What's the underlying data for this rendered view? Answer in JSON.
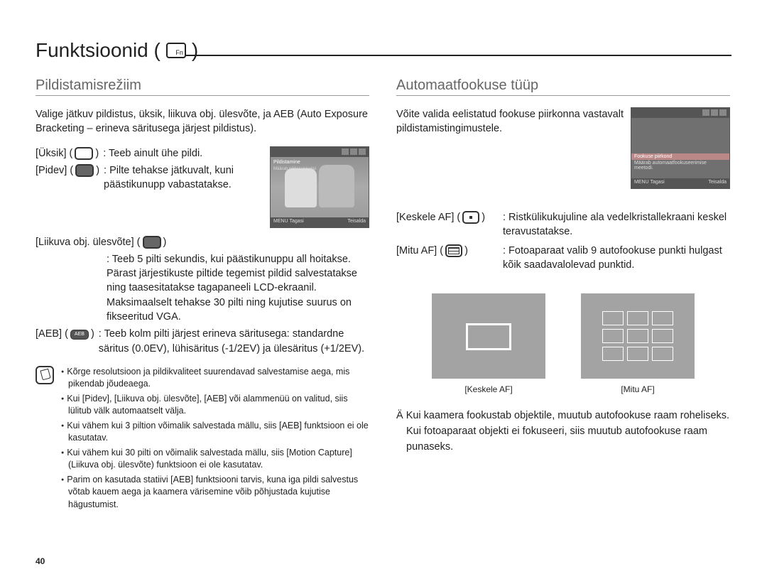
{
  "title": "Funktsioonid (",
  "title_close": ")",
  "left": {
    "heading": "Pildistamisrežiim",
    "intro": "Valige jätkuv pildistus, üksik, liikuva obj. ülesvõte, ja AEB (Auto Exposure Bracketing – erineva säritusega järjest pildistus).",
    "opt_single_label": "[Üksik] (",
    "opt_single_close": ")",
    "opt_single_desc": ": Teeb ainult ühe pildi.",
    "opt_cont_label": "[Pidev] (",
    "opt_cont_close": ")",
    "opt_cont_desc": ": Pilte tehakse jätkuvalt, kuni päästikunupp vabastatakse.",
    "opt_motion_label": "[Liikuva obj. ülesvõte] (",
    "opt_motion_close": ")",
    "opt_motion_desc": ": Teeb 5 pilti sekundis, kui päästikunuppu all hoitakse. Pärast järjestikuste piltide tegemist pildid salvestatakse ning taasesitatakse tagapaneeli LCD-ekraanil. Maksimaalselt tehakse 30 pilti ning kujutise suurus on fikseeritud VGA.",
    "opt_aeb_label": "[AEB] (",
    "opt_aeb_close": ")",
    "opt_aeb_desc": ": Teeb kolm pilti järjest erineva säritusega: standardne säritus (0.0EV), lühisäritus (-1/2EV) ja ülesäritus (+1/2EV).",
    "thumb_label": "Pildistamine",
    "thumb_sub": "Määrab pildistamisviisi",
    "thumb_back": "Tagasi",
    "thumb_move": "Teisalda",
    "thumb_menu": "MENU",
    "notes": [
      "Kõrge resolutsioon ja pildikvaliteet suurendavad salvestamise aega, mis pikendab jõudeaega.",
      "Kui [Pidev], [Liikuva obj. ülesvõte], [AEB] või alammenüü on valitud, siis lülitub välk automaatselt välja.",
      "Kui vähem kui 3 piltion võimalik salvestada mällu, siis [AEB] funktsioon ei ole kasutatav.",
      "Kui vähem kui 30 pilti on võimalik salvestada mällu, siis [Motion Capture](Liikuva obj. ülesvõte) funktsioon ei ole kasutatav.",
      "Parim on kasutada statiivi [AEB] funktsiooni tarvis, kuna iga pildi salvestus võtab kauem aega ja kaamera värisemine võib põhjustada kujutise hägustumist."
    ]
  },
  "right": {
    "heading": "Automaatfookuse tüüp",
    "intro": "Võite valida eelistatud fookuse piirkonna vastavalt pildistamistingimustele.",
    "thumb_hi": "Fookuse piirkond",
    "thumb_sub": "Määrab automaatfookuseerimise meetodi.",
    "thumb_back": "Tagasi",
    "thumb_move": "Teisalda",
    "thumb_menu": "MENU",
    "opt_center_label": "[Keskele AF] (",
    "opt_center_close": ")",
    "opt_center_desc": ": Ristkülikukujuline ala vedelkristallekraani keskel teravustatakse.",
    "opt_multi_label": "[Mitu AF] (",
    "opt_multi_close": ")",
    "opt_multi_desc": ": Fotoaparaat valib 9 autofookuse punkti hulgast kõik saadavalolevad punktid.",
    "fig_center": "[Keskele AF]",
    "fig_multi": "[Mitu AF]",
    "asterisk": "Ä Kui kaamera fookustab objektile, muutub autofookuse raam roheliseks. Kui fotoaparaat objekti ei fokuseeri, siis muutub autofookuse raam punaseks."
  },
  "page_number": "40"
}
